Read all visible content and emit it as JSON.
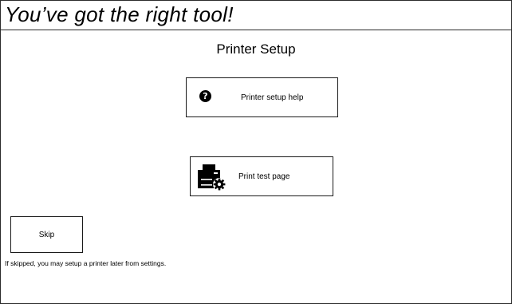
{
  "banner": {
    "title": "You’ve got the right tool!"
  },
  "page": {
    "title": "Printer Setup"
  },
  "actions": {
    "help": {
      "label": "Printer setup help",
      "icon": "question-circle-icon"
    },
    "print_test": {
      "label": "Print test page",
      "icon": "printer-settings-icon"
    }
  },
  "skip": {
    "label": "Skip",
    "note": "If skipped, you may setup a printer later from settings."
  },
  "colors": {
    "border": "#1a1a1a",
    "background": "#ffffff",
    "text": "#000000"
  }
}
